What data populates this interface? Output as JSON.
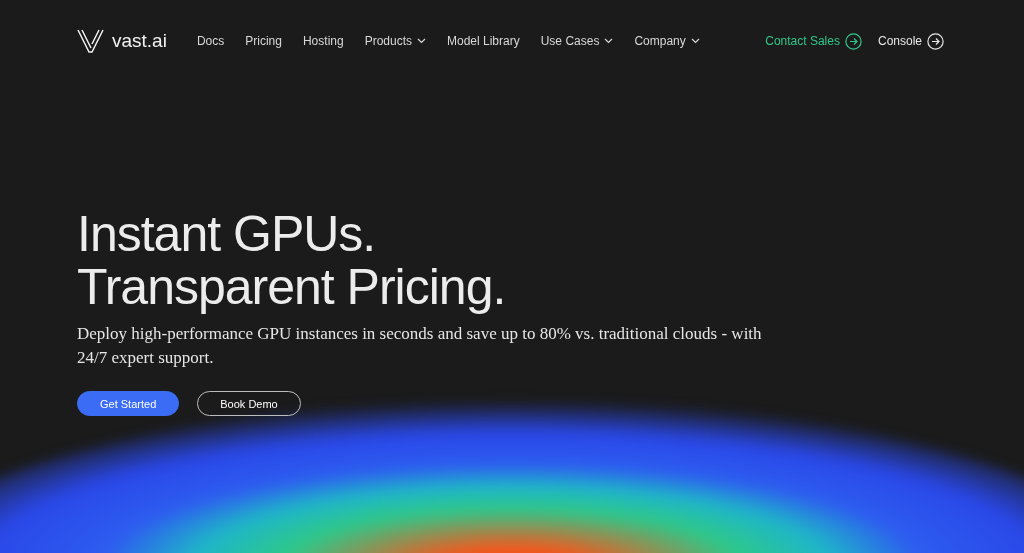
{
  "brand": {
    "name": "vast.ai"
  },
  "nav": [
    {
      "label": "Docs",
      "kind": "link"
    },
    {
      "label": "Pricing",
      "kind": "link"
    },
    {
      "label": "Hosting",
      "kind": "link"
    },
    {
      "label": "Products",
      "kind": "dropdown"
    },
    {
      "label": "Model Library",
      "kind": "link"
    },
    {
      "label": "Use Cases",
      "kind": "dropdown"
    },
    {
      "label": "Company",
      "kind": "dropdown"
    }
  ],
  "actions": [
    {
      "label": "Contact Sales",
      "color": "#2ec98a"
    },
    {
      "label": "Console",
      "color": "#e8e8e8"
    }
  ],
  "hero": {
    "title_lines": [
      "Instant GPUs.",
      "Transparent Pricing."
    ],
    "subtitle": "Deploy high-performance GPU instances in seconds and save up to 80% vs. traditional clouds - with 24/7 expert support.",
    "buttons": [
      {
        "label": "Get Started",
        "kind": "primary"
      },
      {
        "label": "Book Demo",
        "kind": "outline"
      }
    ]
  }
}
